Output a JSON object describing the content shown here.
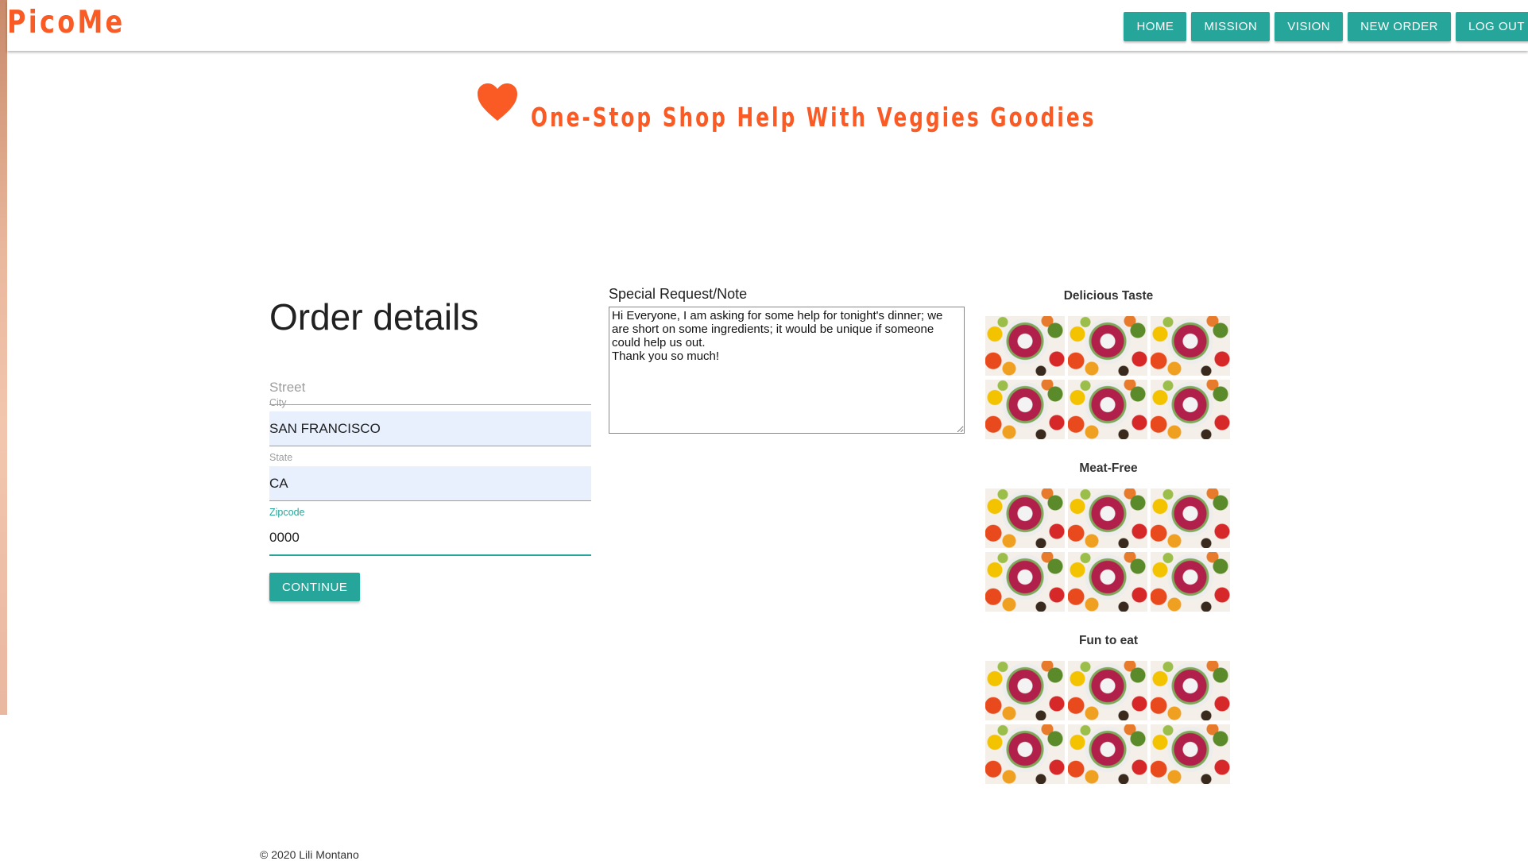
{
  "app": {
    "logo": "PicoMe"
  },
  "nav": {
    "items": [
      {
        "label": "HOME"
      },
      {
        "label": "MISSION"
      },
      {
        "label": "VISION"
      },
      {
        "label": "NEW ORDER"
      },
      {
        "label": "LOG OUT"
      }
    ]
  },
  "hero": {
    "icon": "heart-icon",
    "tagline": "One-Stop Shop Help With Veggies Goodies"
  },
  "order": {
    "title": "Order details",
    "street": {
      "label": "",
      "value": "",
      "placeholder": "Street"
    },
    "city": {
      "label": "City",
      "value": "SAN FRANCISCO"
    },
    "state": {
      "label": "State",
      "value": "CA"
    },
    "zipcode": {
      "label": "Zipcode",
      "value": "0000"
    },
    "continue_label": "CONTINUE"
  },
  "note": {
    "label": "Special Request/Note",
    "value": "Hi Everyone, I am asking for some help for tonight's dinner; we are short on some ingredients; it would be unique if someone could help us out.\nThank you so much!"
  },
  "gallery": {
    "sections": [
      {
        "title": "Delicious Taste"
      },
      {
        "title": "Meat-Free"
      },
      {
        "title": "Fun to eat"
      }
    ]
  },
  "footer": {
    "text": "© 2020 Lili Montano"
  },
  "colors": {
    "brand": "#fa5a24",
    "accent": "#26a69a"
  }
}
